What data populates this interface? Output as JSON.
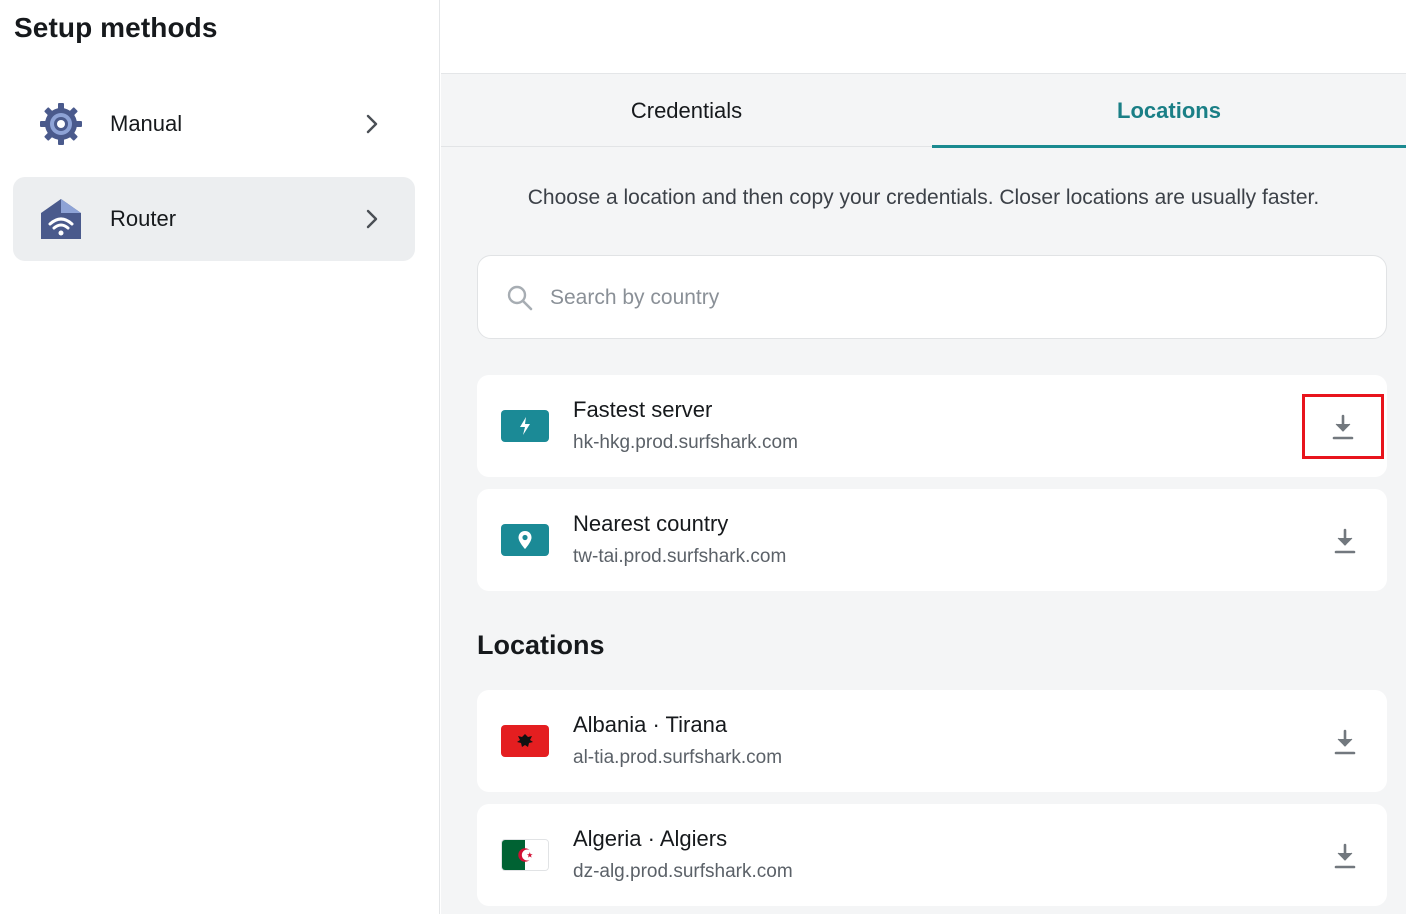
{
  "sidebar": {
    "title": "Setup methods",
    "items": [
      {
        "label": "Manual",
        "icon": "gear-icon",
        "selected": false
      },
      {
        "label": "Router",
        "icon": "router-wifi-icon",
        "selected": true
      }
    ]
  },
  "tabs": [
    {
      "label": "Credentials",
      "active": false
    },
    {
      "label": "Locations",
      "active": true
    }
  ],
  "hint": "Choose a location and then copy your credentials. Closer locations are usually faster.",
  "search": {
    "placeholder": "Search by country",
    "value": ""
  },
  "quick": [
    {
      "name": "Fastest server",
      "host": "hk-hkg.prod.surfshark.com",
      "icon": "lightning-icon"
    },
    {
      "name": "Nearest country",
      "host": "tw-tai.prod.surfshark.com",
      "icon": "location-pin-icon"
    }
  ],
  "locations_title": "Locations",
  "locations": [
    {
      "name": "Albania · Tirana",
      "host": "al-tia.prod.surfshark.com",
      "icon": "albania-flag-icon"
    },
    {
      "name": "Algeria · Algiers",
      "host": "dz-alg.prod.surfshark.com",
      "icon": "algeria-flag-icon"
    }
  ],
  "colors": {
    "accent": "#1a8a90",
    "badge": "#1b8a96",
    "highlight": "#e8141c"
  }
}
